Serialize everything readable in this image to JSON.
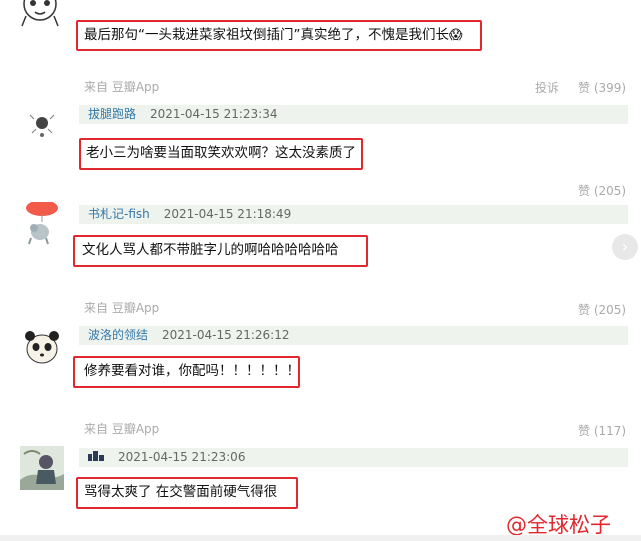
{
  "comments": [
    {
      "text": "最后那句“一头栽进菜家祖坟倒插门”真实绝了，不愧是我们长",
      "emoji": "😱"
    },
    {
      "source": "来自 豆瓣App",
      "report": "投诉",
      "like": "赞 (399)",
      "username": "拔腿跑路",
      "time": "2021-04-15 21:23:34",
      "text": "老小三为啥要当面取笑欢欢啊？这太没素质了"
    },
    {
      "like": "赞 (205)",
      "username": "书札记-fish",
      "time": "2021-04-15 21:18:49",
      "text": "文化人骂人都不带脏字儿的啊哈哈哈哈哈哈"
    },
    {
      "source": "来自 豆瓣App",
      "like": "赞 (205)",
      "username": "波洛的领结",
      "time": "2021-04-15 21:26:12",
      "text": "修养要看对谁，你配吗！！！！！！"
    },
    {
      "source": "来自 豆瓣App",
      "like": "赞 (117)",
      "username": "",
      "time": "2021-04-15 21:23:06",
      "text": "骂得太爽了 在交警面前硬气得很"
    }
  ],
  "next_icon": "chevron-right-icon",
  "watermark": "@全球松子",
  "colors": {
    "highlight": "#e0282e",
    "username": "#3377aa",
    "header_bg": "#eef4ed"
  }
}
